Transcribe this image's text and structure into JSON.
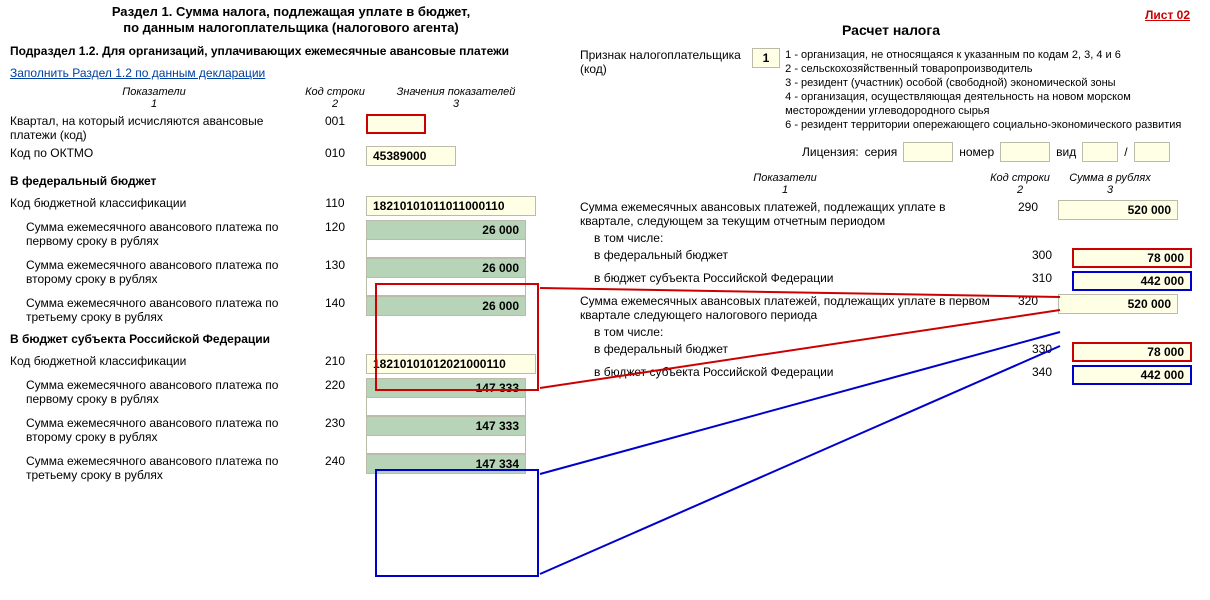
{
  "leftHeader1": "Раздел 1. Сумма налога, подлежащая уплате в бюджет,",
  "leftHeader2": "по данным налогоплательщика (налогового агента)",
  "leftSub": "Подраздел 1.2. Для организаций, уплачивающих ежемесячные авансовые платежи",
  "fillLink": "Заполнить Раздел 1.2 по данным декларации",
  "cols": {
    "c1": "Показатели",
    "c1n": "1",
    "c2": "Код строки",
    "c2n": "2",
    "c3": "Значения показателей",
    "c3n": "3"
  },
  "rows": {
    "r001": {
      "label": "Квартал, на который исчисляются авансовые платежи (код)",
      "code": "001",
      "val": ""
    },
    "r010": {
      "label": "Код по ОКТМО",
      "code": "010",
      "val": "45389000"
    },
    "secFed": "В федеральный бюджет",
    "r110": {
      "label": "Код бюджетной классификации",
      "code": "110",
      "val": "18210101011011000110"
    },
    "r120": {
      "label": "Сумма ежемесячного авансового платежа по первому сроку в рублях",
      "code": "120",
      "val": "26 000"
    },
    "r130": {
      "label": "Сумма ежемесячного авансового платежа по второму сроку в рублях",
      "code": "130",
      "val": "26 000"
    },
    "r140": {
      "label": "Сумма ежемесячного авансового платежа по третьему сроку в рублях",
      "code": "140",
      "val": "26 000"
    },
    "secReg": "В бюджет субъекта Российской Федерации",
    "r210": {
      "label": "Код бюджетной классификации",
      "code": "210",
      "val": "18210101012021000110"
    },
    "r220": {
      "label": "Сумма ежемесячного авансового платежа по первому сроку в рублях",
      "code": "220",
      "val": "147 333"
    },
    "r230": {
      "label": "Сумма ежемесячного авансового платежа по второму сроку в рублях",
      "code": "230",
      "val": "147 333"
    },
    "r240": {
      "label": "Сумма ежемесячного авансового платежа по третьему сроку в рублях",
      "code": "240",
      "val": "147 334"
    }
  },
  "list02": "Лист 02",
  "calcTitle": "Расчет налога",
  "taxSign": {
    "label": "Признак налогоплательщика (код)",
    "val": "1"
  },
  "desc": [
    "1 - организация, не относящаяся к указанным по кодам 2, 3, 4 и 6",
    "2 - сельскохозяйственный товаропроизводитель",
    "3 - резидент (участник) особой (свободной) экономической зоны",
    "4 - организация, осуществляющая деятельность на новом морском месторождении углеводородного сырья",
    "6 - резидент территории опережающего социально-экономического развития"
  ],
  "lic": {
    "l": "Лицензия:",
    "s": "серия",
    "n": "номер",
    "v": "вид",
    "slash": "/"
  },
  "rcols": {
    "c1": "Показатели",
    "c1n": "1",
    "c2": "Код строки",
    "c2n": "2",
    "c3": "Сумма в рублях",
    "c3n": "3"
  },
  "rrows": {
    "r290": {
      "label": "Сумма ежемесячных авансовых платежей, подлежащих уплате в квартале, следующем за текущим отчетным периодом",
      "code": "290",
      "val": "520 000"
    },
    "incl": "в том числе:",
    "r300": {
      "label": "в федеральный бюджет",
      "code": "300",
      "val": "78 000"
    },
    "r310": {
      "label": "в бюджет субъекта Российской Федерации",
      "code": "310",
      "val": "442 000"
    },
    "r320": {
      "label": "Сумма ежемесячных авансовых платежей, подлежащих уплате в первом квартале следующего налогового периода",
      "code": "320",
      "val": "520 000"
    },
    "r330": {
      "label": "в федеральный бюджет",
      "code": "330",
      "val": "78 000"
    },
    "r340": {
      "label": "в бюджет субъекта Российской Федерации",
      "code": "340",
      "val": "442 000"
    }
  }
}
